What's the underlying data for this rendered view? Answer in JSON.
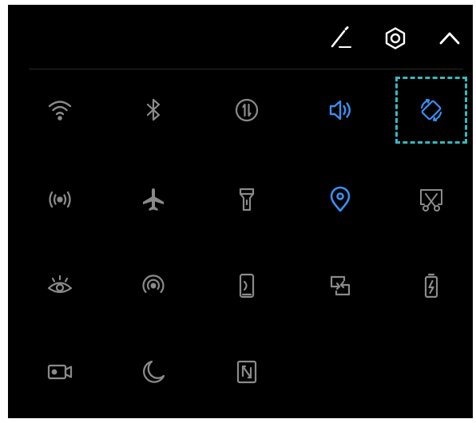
{
  "colors": {
    "background": "#000000",
    "icon_inactive": "#8a8a8a",
    "icon_active": "#3a8ff0",
    "header_icon": "#ffffff",
    "focus_outline": "#38b8c0"
  },
  "header": {
    "buttons": [
      {
        "icon": "pencil-edit-icon"
      },
      {
        "icon": "gear-icon"
      },
      {
        "icon": "chevron-up-icon"
      }
    ]
  },
  "tiles": [
    {
      "icon": "wifi-icon",
      "active": false
    },
    {
      "icon": "bluetooth-icon",
      "active": false
    },
    {
      "icon": "mobile-data-icon",
      "active": false
    },
    {
      "icon": "sound-icon",
      "active": true
    },
    {
      "icon": "auto-rotate-icon",
      "active": true,
      "focused": true
    },
    {
      "icon": "hotspot-icon",
      "active": false
    },
    {
      "icon": "airplane-icon",
      "active": false
    },
    {
      "icon": "flashlight-icon",
      "active": false
    },
    {
      "icon": "location-icon",
      "active": true
    },
    {
      "icon": "screenshot-icon",
      "active": false
    },
    {
      "icon": "eye-comfort-icon",
      "active": false
    },
    {
      "icon": "nearby-share-icon",
      "active": false
    },
    {
      "icon": "screen-cast-icon",
      "active": false
    },
    {
      "icon": "data-sync-icon",
      "active": false
    },
    {
      "icon": "battery-saver-icon",
      "active": false
    },
    {
      "icon": "screen-recorder-icon",
      "active": false
    },
    {
      "icon": "do-not-disturb-icon",
      "active": false
    },
    {
      "icon": "nfc-icon",
      "active": false
    }
  ]
}
